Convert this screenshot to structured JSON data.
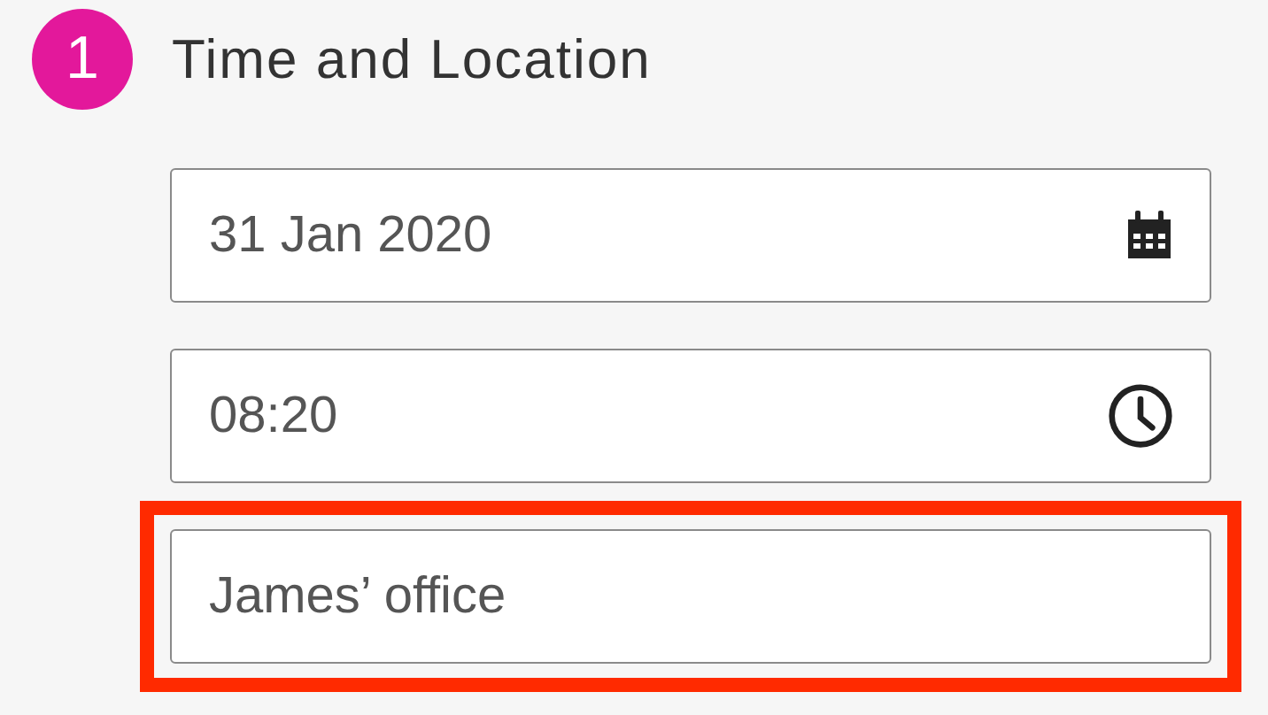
{
  "step": {
    "number": "1",
    "title": "Time and Location"
  },
  "fields": [
    {
      "kind": "date",
      "value": "31 Jan 2020",
      "highlighted": false
    },
    {
      "kind": "time",
      "value": "08:20",
      "highlighted": false
    },
    {
      "kind": "text",
      "value": "James’ office",
      "highlighted": true
    }
  ]
}
